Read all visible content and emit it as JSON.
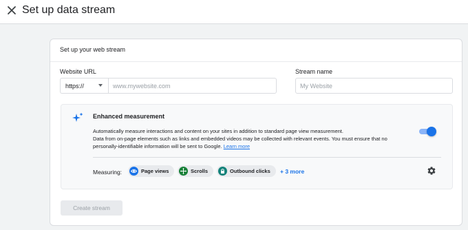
{
  "header": {
    "title": "Set up data stream",
    "close_icon": "close-icon"
  },
  "card": {
    "title": "Set up your web stream",
    "website_url": {
      "label": "Website URL",
      "protocol_value": "https://",
      "placeholder": "www.mywebsite.com"
    },
    "stream_name": {
      "label": "Stream name",
      "placeholder": "My Website"
    },
    "enhanced_measurement": {
      "title": "Enhanced measurement",
      "icon": "sparkle-icon",
      "description_line1": "Automatically measure interactions and content on your sites in addition to standard page view measurement.",
      "description_line2": "Data from on-page elements such as links and embedded videos may be collected with relevant events. You must ensure that no personally-identifiable information will be sent to Google.",
      "learn_more": "Learn more",
      "toggle_on": true,
      "measuring_label": "Measuring:",
      "chips": [
        {
          "label": "Page views",
          "icon": "eye-icon",
          "color": "#1a73e8"
        },
        {
          "label": "Scrolls",
          "icon": "crosshair-icon",
          "color": "#188038"
        },
        {
          "label": "Outbound clicks",
          "icon": "lock-icon",
          "color": "#12827a"
        }
      ],
      "more_label": "+ 3 more",
      "settings_icon": "gear-icon"
    },
    "create_button": "Create stream"
  },
  "colors": {
    "accent": "#1a73e8",
    "page_background": "#f1f3f4",
    "panel_background": "#f8f9fa"
  }
}
